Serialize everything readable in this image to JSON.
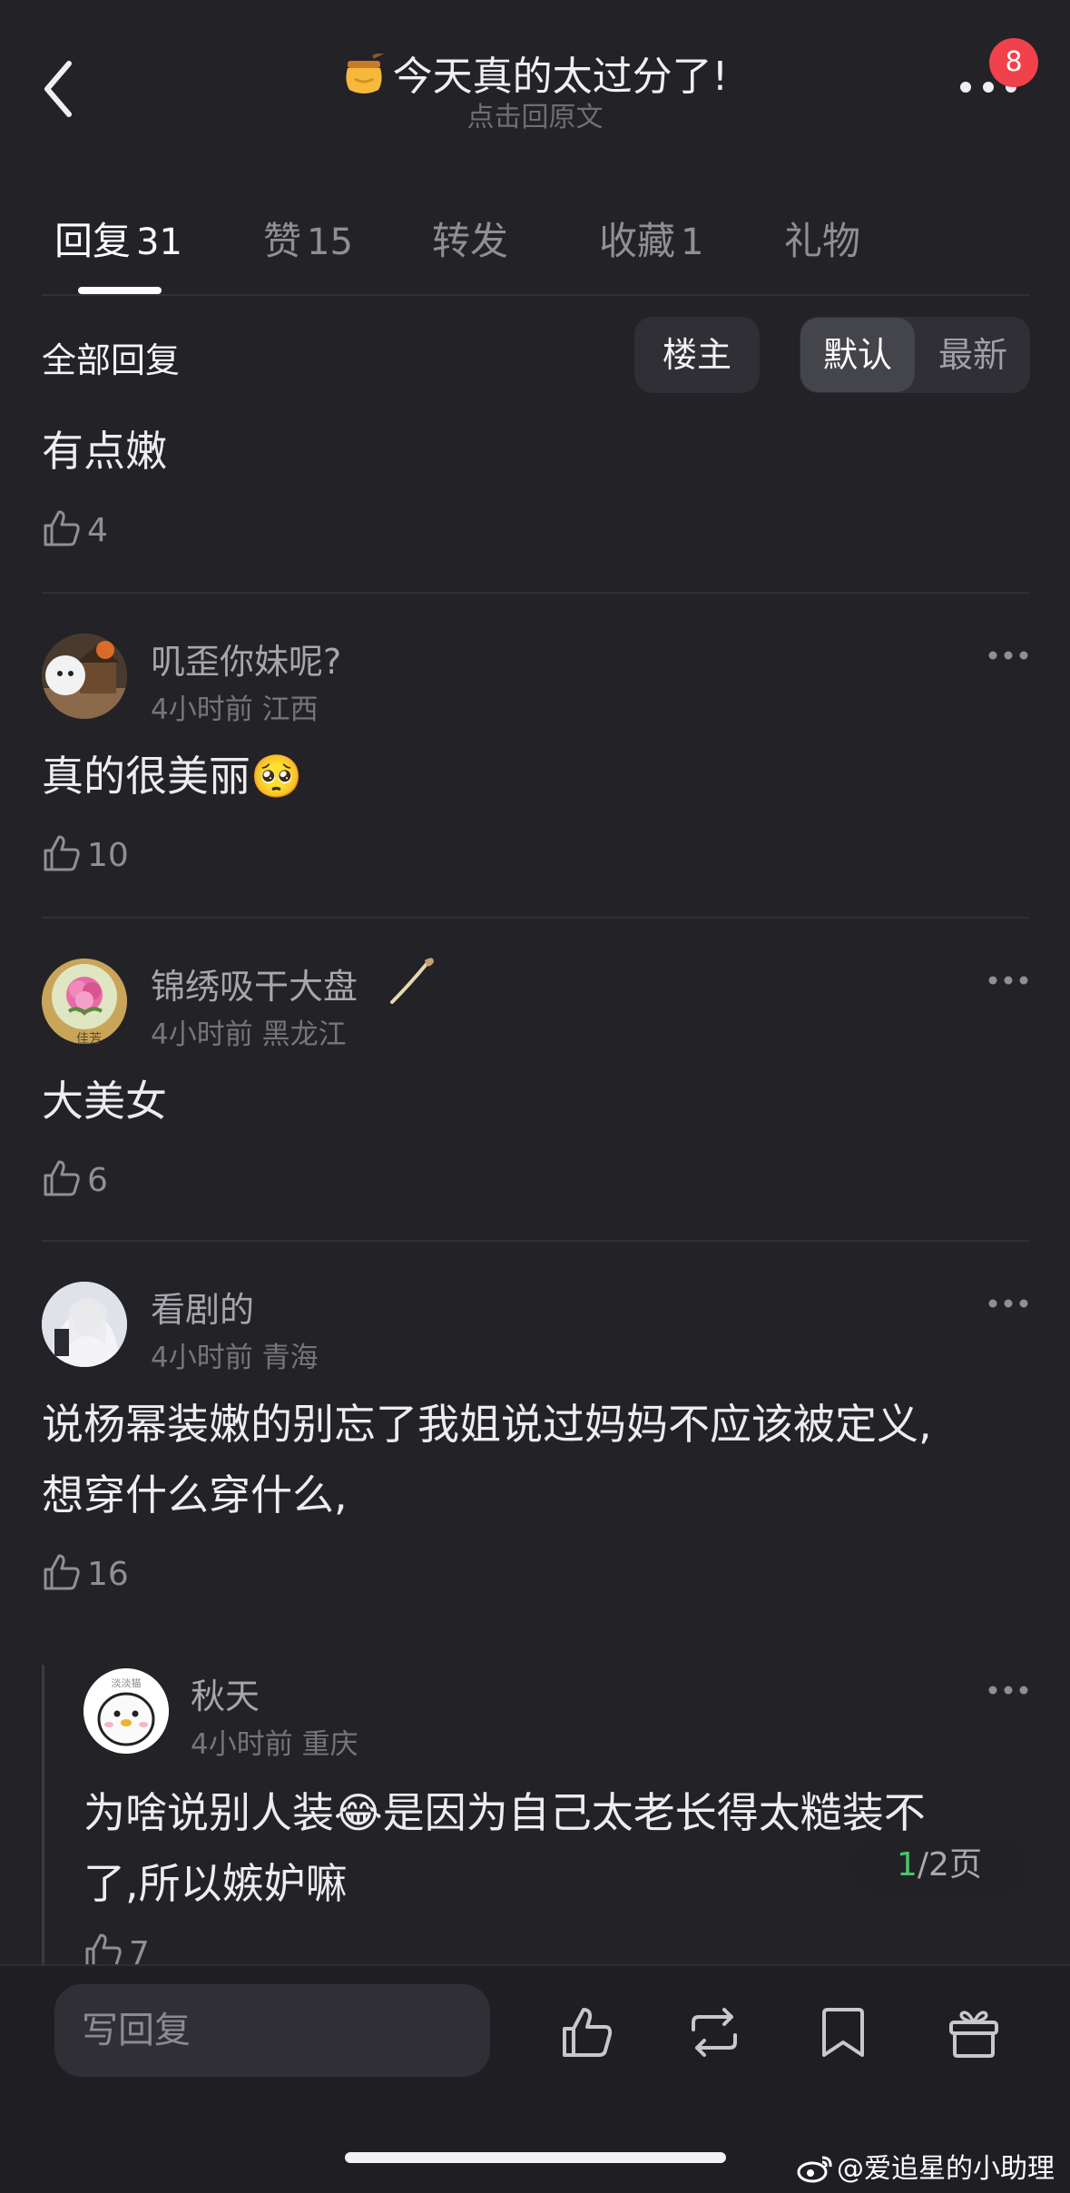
{
  "header": {
    "title": "今天真的太过分了!",
    "subtitle": "点击回原文",
    "badge": "8"
  },
  "tabs": [
    {
      "label": "回复",
      "count": "31"
    },
    {
      "label": "赞",
      "count": "15"
    },
    {
      "label": "转发",
      "count": ""
    },
    {
      "label": "收藏",
      "count": "1"
    },
    {
      "label": "礼物",
      "count": ""
    }
  ],
  "filter": {
    "section_title": "全部回复",
    "op_label": "楼主",
    "sort_default": "默认",
    "sort_latest": "最新"
  },
  "comments": [
    {
      "text": "有点嫩",
      "likes": "4"
    },
    {
      "username": "叽歪你妹呢?",
      "time": "4小时前",
      "location": "江西",
      "text": "真的很美丽",
      "emoji": "🥺",
      "likes": "10"
    },
    {
      "username": "锦绣吸干大盘",
      "time": "4小时前",
      "location": "黑龙江",
      "text": "大美女",
      "likes": "6",
      "avatar_text": "佳芳"
    },
    {
      "username": "看剧的",
      "time": "4小时前",
      "location": "青海",
      "text_line1": "说杨幂装嫩的别忘了我姐说过妈妈不应该被定义,",
      "text_line2": "想穿什么穿什么,",
      "likes": "16"
    },
    {
      "username": "秋天",
      "time": "4小时前",
      "location": "重庆",
      "text_a": "为啥说别人装",
      "emoji": "😂",
      "text_b": "是因为自己太老长得太糙装不",
      "text_line2": "了,所以嫉妒嘛",
      "likes": "7"
    }
  ],
  "pager": {
    "current": "1",
    "total": "/2页"
  },
  "bottom": {
    "reply_placeholder": "写回复"
  },
  "watermark": "@爱追星的小助理",
  "colors": {
    "background": "#222227",
    "badge": "#f1414b",
    "page_current": "#4cc46a"
  }
}
